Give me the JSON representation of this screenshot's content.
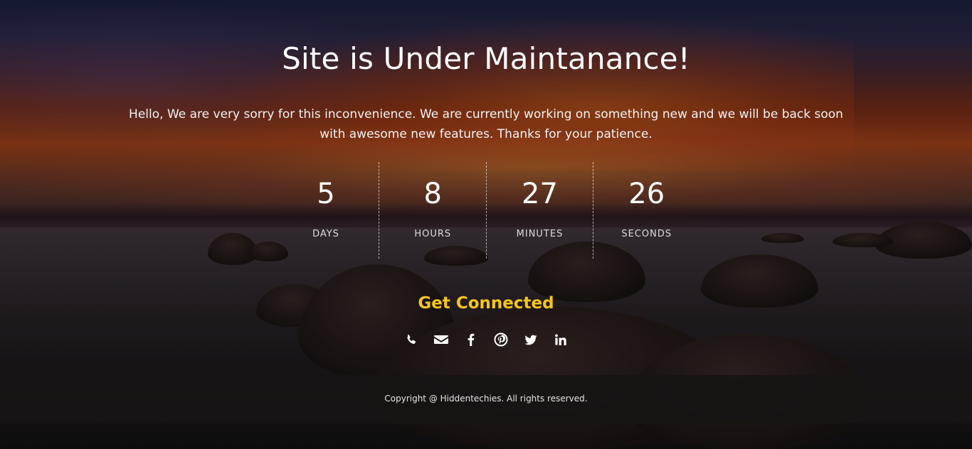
{
  "page": {
    "title": "Site is Under Maintanance!",
    "message": "Hello, We are very sorry for this inconvenience. We are currently working on something new and we will be back soon with awesome new features. Thanks for your patience."
  },
  "countdown": [
    {
      "value": "5",
      "label": "DAYS"
    },
    {
      "value": "8",
      "label": "HOURS"
    },
    {
      "value": "27",
      "label": "MINUTES"
    },
    {
      "value": "26",
      "label": "SECONDS"
    }
  ],
  "connect": {
    "heading": "Get Connected",
    "accent_color": "#f7c51e",
    "icons": [
      "phone-icon",
      "envelope-icon",
      "facebook-icon",
      "pinterest-icon",
      "twitter-icon",
      "linkedin-icon"
    ]
  },
  "footer": {
    "copyright": "Copyright @ Hiddentechies. All rights reserved."
  }
}
